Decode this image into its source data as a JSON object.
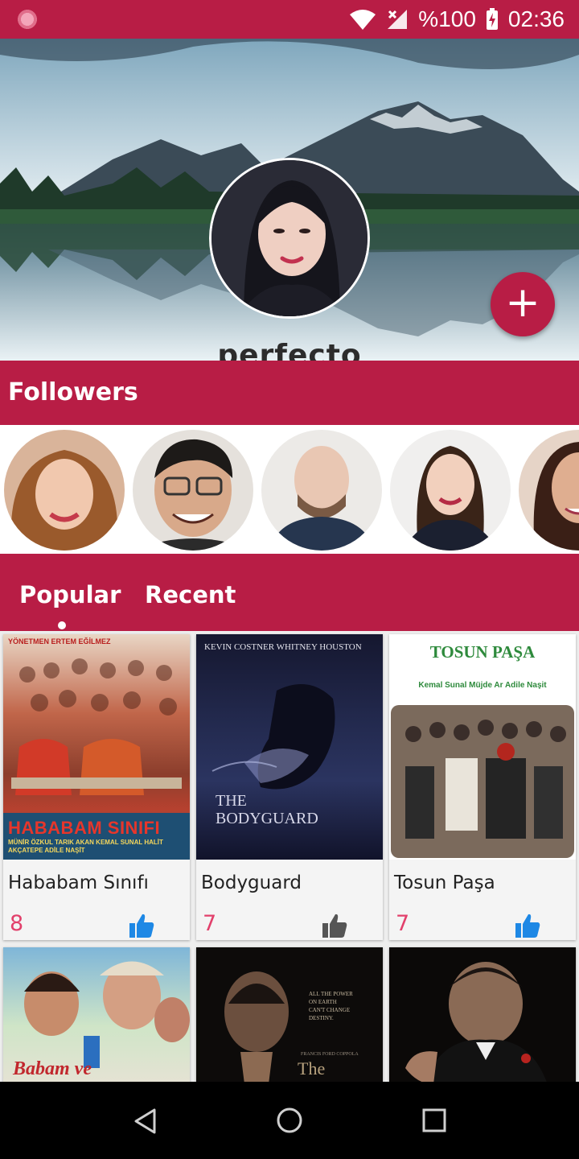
{
  "status_bar": {
    "battery": "%100",
    "time": "02:36"
  },
  "profile": {
    "username": "perfecto",
    "fab_icon": "add-icon"
  },
  "followers": {
    "title": "Followers"
  },
  "tabs": {
    "items": [
      {
        "label": "Popular"
      },
      {
        "label": "Recent"
      }
    ],
    "selected": "Popular"
  },
  "movies": [
    {
      "title": "Hababam Sınıfı",
      "likes": "8",
      "liked": true,
      "poster": {
        "top": "YÖNETMEN ERTEM EĞİLMEZ",
        "main": "HABABAM SINIFI",
        "credits": "MÜNİR ÖZKUL  TARIK AKAN  KEMAL SUNAL  HALİT AKÇATEPE  ADİLE NAŞİT"
      }
    },
    {
      "title": "Bodyguard",
      "likes": "7",
      "liked": false,
      "poster": {
        "top": "KEVIN COSTNER   WHITNEY HOUSTON",
        "main": "THE BODYGUARD"
      }
    },
    {
      "title": "Tosun Paşa",
      "likes": "7",
      "liked": true,
      "poster": {
        "main": "TOSUN PAŞA",
        "credits": "Kemal Sunal   Müjde Ar   Adile Naşit"
      }
    },
    {
      "title": "",
      "likes": "",
      "poster": {
        "main": "Babam ve"
      }
    },
    {
      "title": "",
      "likes": "",
      "poster": {
        "main": "The"
      }
    },
    {
      "title": "",
      "likes": "",
      "poster": {
        "main": ""
      }
    }
  ],
  "colors": {
    "primary": "#b81d45",
    "accent_count": "#e2406b",
    "like_active": "#1e88e5",
    "like_inactive": "#555555"
  }
}
